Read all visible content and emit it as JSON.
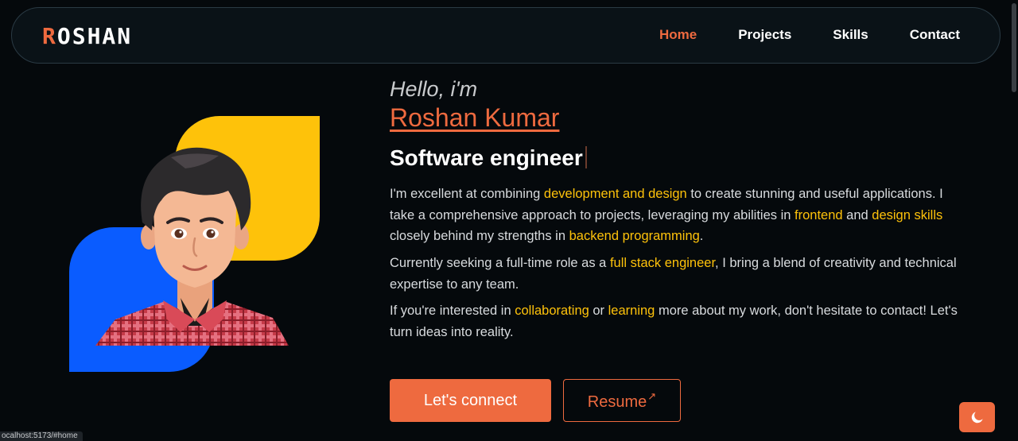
{
  "header": {
    "logo_first": "R",
    "logo_rest": "OSHAN",
    "nav": [
      {
        "label": "Home",
        "active": true
      },
      {
        "label": "Projects",
        "active": false
      },
      {
        "label": "Skills",
        "active": false
      },
      {
        "label": "Contact",
        "active": false
      }
    ]
  },
  "hero": {
    "greeting": "Hello, i'm",
    "name": "Roshan Kumar",
    "role": "Software engineer",
    "p1": {
      "t1": "I'm excellent at combining ",
      "h1": "development and design",
      "t2": " to create stunning and useful applications. I take a comprehensive approach to projects, leveraging my abilities in ",
      "h2": "frontend",
      "t3": " and ",
      "h3": "design skills",
      "t4": " closely behind my strengths in ",
      "h4": "backend programming",
      "t5": "."
    },
    "p2": {
      "t1": "Currently seeking a full-time role as a ",
      "h1": "full stack engineer",
      "t2": ", I bring a blend of creativity and technical expertise to any team."
    },
    "p3": {
      "t1": "If you're interested in ",
      "h1": "collaborating",
      "t2": " or ",
      "h2": "learning",
      "t3": " more about my work, don't hesitate to contact! Let's turn ideas into reality."
    },
    "buttons": {
      "connect": "Let's connect",
      "resume": "Resume",
      "resume_arrow": "↗"
    }
  },
  "status_bar": {
    "url": "ocalhost:5173/#home"
  },
  "colors": {
    "accent": "#ee6a3f",
    "highlight": "#fec20a",
    "blue_shape": "#0a5cff",
    "background": "#05090c"
  },
  "icons": {
    "theme_toggle": "moon-icon",
    "resume_link": "external-arrow-icon"
  }
}
